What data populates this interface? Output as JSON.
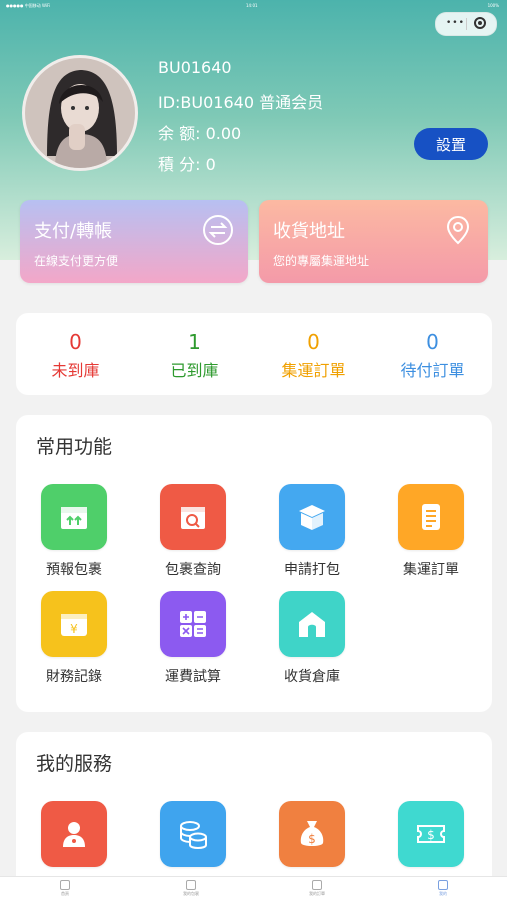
{
  "status_bar": {
    "left": "●●●●● 中国移动 WiFi",
    "time": "14:01",
    "right": "100%"
  },
  "profile": {
    "username": "BU01640",
    "id_line": "ID:BU01640 普通会员",
    "balance_line": "余 额: 0.00",
    "points_line": "積 分: 0",
    "settings_label": "設置"
  },
  "actions": [
    {
      "title": "支付/轉帳",
      "subtitle": "在線支付更方便",
      "icon": "transfer-icon"
    },
    {
      "title": "收貨地址",
      "subtitle": "您的專屬集運地址",
      "icon": "location-pin-icon"
    }
  ],
  "stats": [
    {
      "value": "0",
      "label": "未到庫",
      "color": "#e53935"
    },
    {
      "value": "1",
      "label": "已到庫",
      "color": "#2e9a2e"
    },
    {
      "value": "0",
      "label": "集運訂單",
      "color": "#f0a000"
    },
    {
      "value": "0",
      "label": "待付訂單",
      "color": "#3d8fe0"
    }
  ],
  "common_functions": {
    "title": "常用功能",
    "items": [
      {
        "label": "預報包裹",
        "icon": "forecast-box-icon",
        "color": "#4fcf6a"
      },
      {
        "label": "包裹查詢",
        "icon": "package-search-icon",
        "color": "#ef5a45"
      },
      {
        "label": "申請打包",
        "icon": "open-box-icon",
        "color": "#44a8f0"
      },
      {
        "label": "集運訂單",
        "icon": "order-document-icon",
        "color": "#ffa726"
      },
      {
        "label": "財務記錄",
        "icon": "wallet-yen-icon",
        "color": "#f6c21c"
      },
      {
        "label": "運費試算",
        "icon": "calculator-icon",
        "color": "#8c5af0"
      },
      {
        "label": "收貨倉庫",
        "icon": "warehouse-icon",
        "color": "#3fd4c8"
      }
    ]
  },
  "services": {
    "title": "我的服務",
    "items": [
      {
        "icon": "user-profile-icon",
        "color": "#ef5a45"
      },
      {
        "icon": "coins-icon",
        "color": "#3fa4ee"
      },
      {
        "icon": "money-bag-icon",
        "color": "#f08040"
      },
      {
        "icon": "coupon-icon",
        "color": "#3fd9d0"
      }
    ]
  },
  "tabbar": [
    {
      "label": "首頁",
      "icon": "home-tab-icon"
    },
    {
      "label": "我的包裹",
      "icon": "package-tab-icon"
    },
    {
      "label": "我的訂單",
      "icon": "order-tab-icon"
    },
    {
      "label": "我的",
      "icon": "profile-tab-icon"
    }
  ]
}
